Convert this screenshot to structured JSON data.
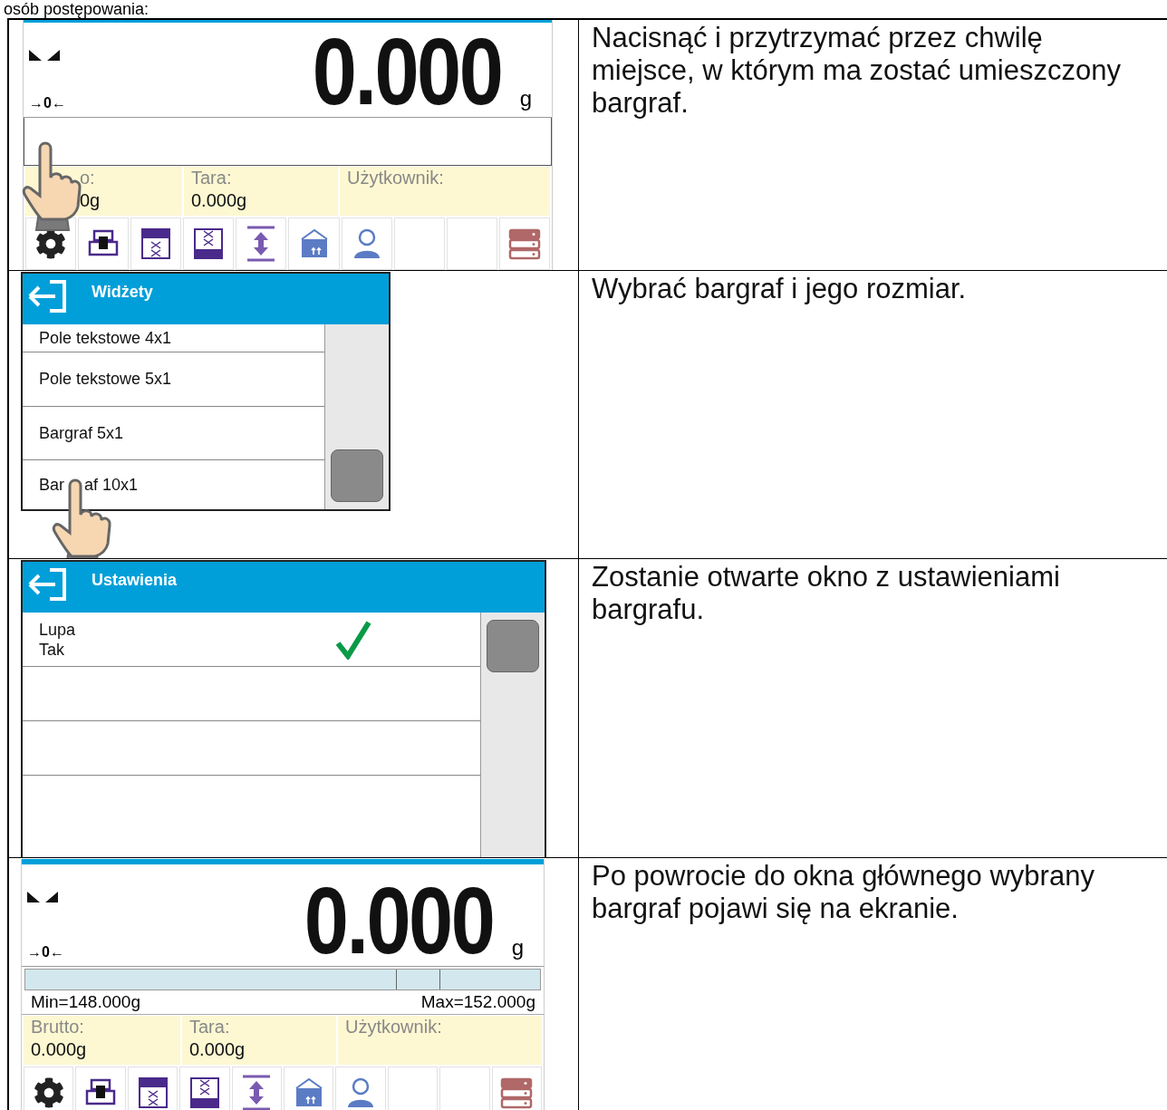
{
  "heading": "osób postępowania:",
  "steps": [
    {
      "kind": "main_screen",
      "hand": true,
      "screen": {
        "weight": "0.000",
        "unit": "g",
        "zero_mark": "→0←",
        "info": [
          {
            "label": "o:",
            "value": "0g"
          },
          {
            "label": "Tara:",
            "value": "0.000g"
          },
          {
            "label": "Użytkownik:"
          }
        ]
      },
      "description": "Nacisnąć i przytrzymać przez chwilę miejsce, w którym ma zostać umieszczony bargraf."
    },
    {
      "kind": "widget_list",
      "hand": true,
      "window": {
        "title": "Widżety",
        "items": [
          {
            "label": "Pole tekstowe 4x1"
          },
          {
            "label": "Pole tekstowe 5x1"
          },
          {
            "label": "Bargraf 5x1"
          },
          {
            "label_parts": [
              "Bar",
              "af 10x1"
            ]
          }
        ]
      },
      "description": "Wybrać bargraf i jego rozmiar."
    },
    {
      "kind": "settings_list",
      "window": {
        "title": "Ustawienia",
        "items": [
          {
            "label": "Lupa",
            "value": "Tak",
            "checked": true
          }
        ]
      },
      "description": "Zostanie otwarte okno z ustawieniami bargrafu."
    },
    {
      "kind": "main_screen",
      "screen": {
        "weight": "0.000",
        "unit": "g",
        "zero_mark": "→0←",
        "bargraph": {
          "min": "Min=148.000g",
          "max": "Max=152.000g"
        },
        "info": [
          {
            "label": "Brutto:",
            "value": "0.000g"
          },
          {
            "label": "Tara:",
            "value": "0.000g"
          },
          {
            "label": "Użytkownik:"
          }
        ]
      },
      "description": "Po powrocie do okna głównego wybrany bargraf pojawi się na ekranie."
    }
  ]
}
